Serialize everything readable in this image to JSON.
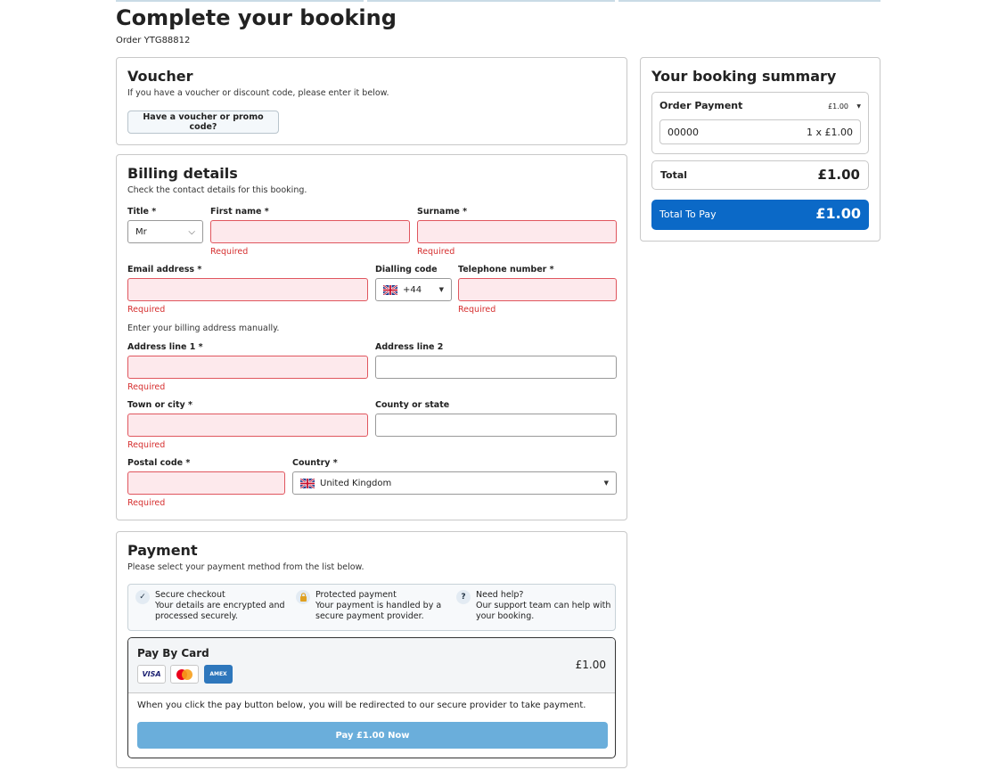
{
  "header": {
    "title": "Complete your booking",
    "order_ref": "Order YTG88812"
  },
  "voucher": {
    "title": "Voucher",
    "subtitle": "If you have a voucher or discount code, please enter it below.",
    "button": "Have a voucher or promo code?"
  },
  "billing": {
    "title": "Billing details",
    "subtitle": "Check the contact details for this booking.",
    "required_text": "Required",
    "title_label": "Title *",
    "title_value": "Mr",
    "first_name_label": "First name *",
    "surname_label": "Surname *",
    "email_label": "Email address *",
    "dialling_label": "Dialling code",
    "dialling_value": "+44",
    "telephone_label": "Telephone number *",
    "manual_note": "Enter your billing address manually.",
    "address1_label": "Address line 1 *",
    "address2_label": "Address line 2",
    "town_label": "Town or city *",
    "county_label": "County or state",
    "postal_label": "Postal code *",
    "country_label": "Country *",
    "country_value": "United Kingdom"
  },
  "payment": {
    "title": "Payment",
    "subtitle": "Please select your payment method from the list below.",
    "assurances": [
      {
        "icon": "check-icon",
        "title": "Secure checkout",
        "line1": "Your details are encrypted and",
        "line2": "processed securely."
      },
      {
        "icon": "lock-icon",
        "title": "Protected payment",
        "line1": "Your payment is handled by a",
        "line2": "secure payment provider."
      },
      {
        "icon": "help-icon",
        "title": "Need help?",
        "line1": "Our support team can help with",
        "line2": "your booking."
      }
    ],
    "method_title": "Pay By Card",
    "method_amount": "£1.00",
    "cards": [
      "VISA",
      "AMEX"
    ],
    "redirect_note": "When you click the pay button below, you will be redirected to our secure provider to take payment.",
    "pay_button": "Pay £1.00 Now"
  },
  "summary": {
    "title": "Your booking summary",
    "item_label": "Order Payment",
    "item_amount": "£1.00",
    "item_code": "00000",
    "item_qty": "1 x £1.00",
    "total_label": "Total",
    "total_amount": "£1.00",
    "to_pay_label": "Total To Pay",
    "to_pay_amount": "£1.00"
  },
  "colors": {
    "accent": "#0b69c7",
    "error": "#d62f2f",
    "error_fill": "#fde9ec",
    "pay_button": "#6aaedb"
  }
}
